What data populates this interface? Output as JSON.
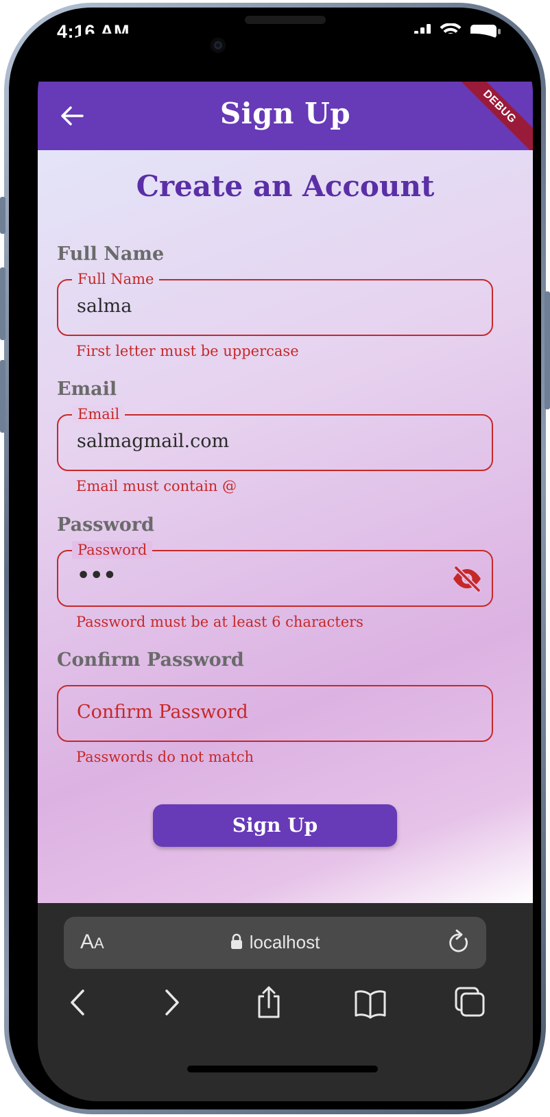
{
  "status_bar": {
    "time": "4:16 AM"
  },
  "app_bar": {
    "title": "Sign Up",
    "debug_banner": "DEBUG"
  },
  "form": {
    "heading": "Create an Account",
    "full_name": {
      "section_label": "Full Name",
      "field_label": "Full Name",
      "value": "salma",
      "error": "First letter must be uppercase"
    },
    "email": {
      "section_label": "Email",
      "field_label": "Email",
      "value": "salmagmail.com",
      "error": "Email must contain @"
    },
    "password": {
      "section_label": "Password",
      "field_label": "Password",
      "value": "•••",
      "error": "Password must be at least 6 characters"
    },
    "confirm_password": {
      "section_label": "Confirm Password",
      "placeholder": "Confirm Password",
      "error": "Passwords do not match"
    },
    "submit_label": "Sign Up"
  },
  "browser": {
    "text_size_big": "A",
    "text_size_small": "A",
    "url": "localhost"
  },
  "colors": {
    "primary": "#673ab7",
    "heading": "#5a2fa6",
    "error": "#c62828",
    "debug_banner": "#9a1a3a"
  },
  "icons": {
    "back": "arrow-left-icon",
    "password_toggle": "eye-off-icon",
    "lock": "lock-icon",
    "reload": "reload-icon",
    "browser_back": "chevron-left-icon",
    "browser_forward": "chevron-right-icon",
    "share": "share-icon",
    "bookmarks": "book-icon",
    "tabs": "tabs-icon"
  }
}
